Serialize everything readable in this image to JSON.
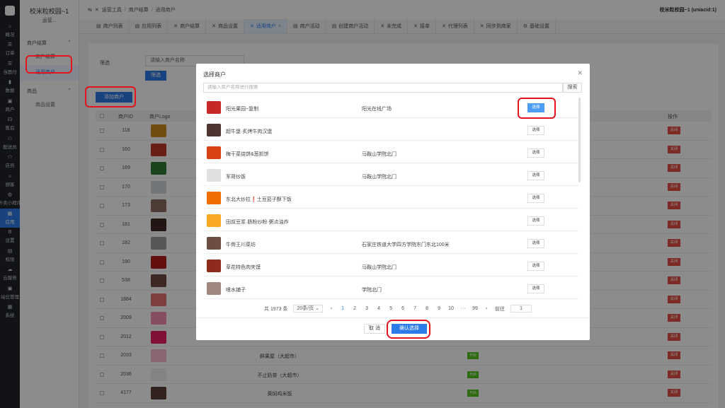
{
  "nav": {
    "items": [
      {
        "label": "概况",
        "icon": "home-icon",
        "glyph": "⌂"
      },
      {
        "label": "订单",
        "icon": "order-icon",
        "glyph": "☰"
      },
      {
        "label": "当面付",
        "icon": "pay-icon",
        "glyph": "☰"
      },
      {
        "label": "数据",
        "icon": "chart-icon",
        "glyph": "▮"
      },
      {
        "label": "商户",
        "icon": "shop-icon",
        "glyph": "▣"
      },
      {
        "label": "售后",
        "icon": "headset-icon",
        "glyph": "☊"
      },
      {
        "label": "配送员",
        "icon": "rider-icon",
        "glyph": "⚇"
      },
      {
        "label": "店员",
        "icon": "staff-icon",
        "glyph": "⚇"
      },
      {
        "label": "顾客",
        "icon": "customer-icon",
        "glyph": "☺"
      },
      {
        "label": "外卖小程序",
        "icon": "wechat-icon",
        "glyph": "◍"
      },
      {
        "label": "应用",
        "icon": "apps-icon",
        "glyph": "▦"
      },
      {
        "label": "设置",
        "icon": "settings-icon",
        "glyph": "⚙"
      },
      {
        "label": "权限",
        "icon": "lock-icon",
        "glyph": "▤"
      },
      {
        "label": "云服务",
        "icon": "cloud-icon",
        "glyph": "☁"
      },
      {
        "label": "站位管理",
        "icon": "station-icon",
        "glyph": "▣"
      },
      {
        "label": "系统",
        "icon": "system-icon",
        "glyph": "▦"
      }
    ]
  },
  "sidebar": {
    "brand": "校米粒校园~1",
    "brand_sub": "运营...",
    "groups": [
      {
        "label": "商户结算",
        "items": [
          "商户结算",
          "适用商户"
        ]
      },
      {
        "label": "商品",
        "items": [
          "商品设置"
        ]
      }
    ]
  },
  "topbar": {
    "breadcrumb": [
      "运营工具",
      "商户结算",
      "适用商户"
    ],
    "store_name": "校米粒校园~1 (uniacid:1)"
  },
  "tabs": [
    {
      "label": "商户列表",
      "icon": "list-icon"
    },
    {
      "label": "应用列表",
      "icon": "list-icon"
    },
    {
      "label": "商户结算",
      "icon": "tool-icon"
    },
    {
      "label": "商品设置",
      "icon": "tool-icon"
    },
    {
      "label": "适用商户",
      "icon": "tool-icon"
    },
    {
      "label": "商户活动",
      "icon": "list-icon"
    },
    {
      "label": "创建商户活动",
      "icon": "list-icon"
    },
    {
      "label": "未完成",
      "icon": "tool-icon"
    },
    {
      "label": "接单",
      "icon": "tool-icon"
    },
    {
      "label": "代理列表",
      "icon": "tool-icon"
    },
    {
      "label": "同步到商家",
      "icon": "tool-icon"
    },
    {
      "label": "基础设置",
      "icon": "gear-icon"
    }
  ],
  "main": {
    "filter_label": "筛选",
    "filter_placeholder": "请输入商户名称",
    "filter_button": "筛选",
    "add_button": "添加商户",
    "columns": [
      "商户ID",
      "商户Logo",
      "操作"
    ],
    "rows": [
      {
        "id": "118",
        "name": "",
        "status": "",
        "action": "关闭",
        "logo_color": "#d08a1f"
      },
      {
        "id": "160",
        "name": "",
        "status": "",
        "action": "关闭",
        "logo_color": "#c0392b"
      },
      {
        "id": "169",
        "name": "",
        "status": "",
        "action": "关闭",
        "logo_color": "#2e7d32"
      },
      {
        "id": "170",
        "name": "",
        "status": "",
        "action": "关闭",
        "logo_color": "#cfd8dc"
      },
      {
        "id": "173",
        "name": "",
        "status": "",
        "action": "关闭",
        "logo_color": "#8d6e63"
      },
      {
        "id": "181",
        "name": "",
        "status": "",
        "action": "关闭",
        "logo_color": "#3e2723"
      },
      {
        "id": "182",
        "name": "",
        "status": "",
        "action": "关闭",
        "logo_color": "#9e9e9e"
      },
      {
        "id": "190",
        "name": "",
        "status": "",
        "action": "关闭",
        "logo_color": "#b71c1c"
      },
      {
        "id": "538",
        "name": "",
        "status": "",
        "action": "关闭",
        "logo_color": "#6d4c41"
      },
      {
        "id": "1884",
        "name": "",
        "status": "",
        "action": "关闭",
        "logo_color": "#e57373"
      },
      {
        "id": "2009",
        "name": "",
        "status": "",
        "action": "关闭",
        "logo_color": "#f48fb1"
      },
      {
        "id": "2012",
        "name": "",
        "status": "",
        "action": "关闭",
        "logo_color": "#e91e63"
      },
      {
        "id": "2033",
        "name": "鲜果屋（大超市）",
        "status": "开启",
        "action": "关闭",
        "logo_color": "#f8bbd0"
      },
      {
        "id": "2036",
        "name": "不止奶茶（大超市）",
        "status": "开启",
        "action": "关闭",
        "logo_color": "#eeeeee"
      },
      {
        "id": "4177",
        "name": "黄焖鸡米饭",
        "status": "开启",
        "action": "关闭",
        "logo_color": "#5d4037"
      }
    ]
  },
  "modal": {
    "title": "选择商户",
    "search_placeholder": "请输入商户名称进行搜索",
    "search_button": "搜索",
    "select_label": "选择",
    "rows": [
      {
        "name": "阳光果园~复制",
        "addr": "阳光在线广场",
        "thumb": "#c62828",
        "selected": true
      },
      {
        "name": "超牛堡·炙烤牛肉汉堡",
        "addr": "",
        "thumb": "#4e342e",
        "selected": false
      },
      {
        "name": "梅干菜烧饼&葱抓饼",
        "addr": "马鞍山学院北门",
        "thumb": "#d84315",
        "selected": false
      },
      {
        "name": "军哥炒饭",
        "addr": "马鞍山学院北门",
        "thumb": "#e0e0e0",
        "selected": false
      },
      {
        "name": "东北大炒拉❗土豆茄子酥下饭",
        "addr": "",
        "thumb": "#ef6c00",
        "selected": false
      },
      {
        "name": "田叔豆浆·肠粉炒粉·粥点油炸",
        "addr": "",
        "thumb": "#f9a825",
        "selected": false
      },
      {
        "name": "牛骨王川菜坊",
        "addr": "石家庄铁道大学四方学院东门东北100米",
        "thumb": "#6d4c41",
        "selected": false
      },
      {
        "name": "草花特色肉夹馍",
        "addr": "马鞍山学院北门",
        "thumb": "#8d2c1c",
        "selected": false
      },
      {
        "name": "嗜水铺子",
        "addr": "学院北门",
        "thumb": "#a1887f",
        "selected": false
      }
    ],
    "pager": {
      "total": "共 1973 条",
      "page_size": "20条/页",
      "pages": [
        "1",
        "2",
        "3",
        "4",
        "5",
        "6",
        "7",
        "8",
        "9",
        "10",
        "···",
        "99"
      ],
      "current": "1",
      "goto_label": "前往",
      "goto_value": "1"
    },
    "cancel": "取 消",
    "confirm": "确认选择"
  },
  "colors": {
    "accent": "#2d7be8",
    "danger": "#e54d42",
    "highlight": "#e3141e"
  }
}
